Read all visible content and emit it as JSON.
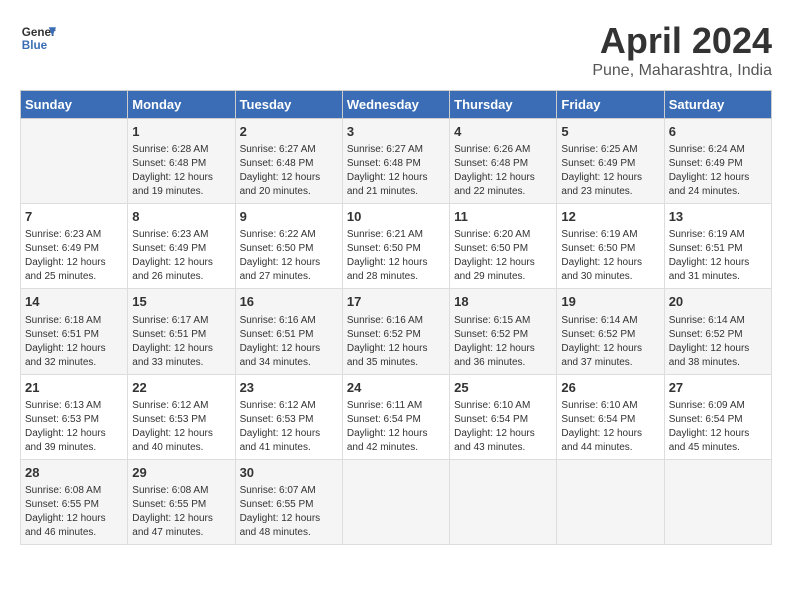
{
  "header": {
    "logo_line1": "General",
    "logo_line2": "Blue",
    "title": "April 2024",
    "subtitle": "Pune, Maharashtra, India"
  },
  "calendar": {
    "columns": [
      "Sunday",
      "Monday",
      "Tuesday",
      "Wednesday",
      "Thursday",
      "Friday",
      "Saturday"
    ],
    "rows": [
      [
        {
          "day": "",
          "sunrise": "",
          "sunset": "",
          "daylight": ""
        },
        {
          "day": "1",
          "sunrise": "Sunrise: 6:28 AM",
          "sunset": "Sunset: 6:48 PM",
          "daylight": "Daylight: 12 hours and 19 minutes."
        },
        {
          "day": "2",
          "sunrise": "Sunrise: 6:27 AM",
          "sunset": "Sunset: 6:48 PM",
          "daylight": "Daylight: 12 hours and 20 minutes."
        },
        {
          "day": "3",
          "sunrise": "Sunrise: 6:27 AM",
          "sunset": "Sunset: 6:48 PM",
          "daylight": "Daylight: 12 hours and 21 minutes."
        },
        {
          "day": "4",
          "sunrise": "Sunrise: 6:26 AM",
          "sunset": "Sunset: 6:48 PM",
          "daylight": "Daylight: 12 hours and 22 minutes."
        },
        {
          "day": "5",
          "sunrise": "Sunrise: 6:25 AM",
          "sunset": "Sunset: 6:49 PM",
          "daylight": "Daylight: 12 hours and 23 minutes."
        },
        {
          "day": "6",
          "sunrise": "Sunrise: 6:24 AM",
          "sunset": "Sunset: 6:49 PM",
          "daylight": "Daylight: 12 hours and 24 minutes."
        }
      ],
      [
        {
          "day": "7",
          "sunrise": "Sunrise: 6:23 AM",
          "sunset": "Sunset: 6:49 PM",
          "daylight": "Daylight: 12 hours and 25 minutes."
        },
        {
          "day": "8",
          "sunrise": "Sunrise: 6:23 AM",
          "sunset": "Sunset: 6:49 PM",
          "daylight": "Daylight: 12 hours and 26 minutes."
        },
        {
          "day": "9",
          "sunrise": "Sunrise: 6:22 AM",
          "sunset": "Sunset: 6:50 PM",
          "daylight": "Daylight: 12 hours and 27 minutes."
        },
        {
          "day": "10",
          "sunrise": "Sunrise: 6:21 AM",
          "sunset": "Sunset: 6:50 PM",
          "daylight": "Daylight: 12 hours and 28 minutes."
        },
        {
          "day": "11",
          "sunrise": "Sunrise: 6:20 AM",
          "sunset": "Sunset: 6:50 PM",
          "daylight": "Daylight: 12 hours and 29 minutes."
        },
        {
          "day": "12",
          "sunrise": "Sunrise: 6:19 AM",
          "sunset": "Sunset: 6:50 PM",
          "daylight": "Daylight: 12 hours and 30 minutes."
        },
        {
          "day": "13",
          "sunrise": "Sunrise: 6:19 AM",
          "sunset": "Sunset: 6:51 PM",
          "daylight": "Daylight: 12 hours and 31 minutes."
        }
      ],
      [
        {
          "day": "14",
          "sunrise": "Sunrise: 6:18 AM",
          "sunset": "Sunset: 6:51 PM",
          "daylight": "Daylight: 12 hours and 32 minutes."
        },
        {
          "day": "15",
          "sunrise": "Sunrise: 6:17 AM",
          "sunset": "Sunset: 6:51 PM",
          "daylight": "Daylight: 12 hours and 33 minutes."
        },
        {
          "day": "16",
          "sunrise": "Sunrise: 6:16 AM",
          "sunset": "Sunset: 6:51 PM",
          "daylight": "Daylight: 12 hours and 34 minutes."
        },
        {
          "day": "17",
          "sunrise": "Sunrise: 6:16 AM",
          "sunset": "Sunset: 6:52 PM",
          "daylight": "Daylight: 12 hours and 35 minutes."
        },
        {
          "day": "18",
          "sunrise": "Sunrise: 6:15 AM",
          "sunset": "Sunset: 6:52 PM",
          "daylight": "Daylight: 12 hours and 36 minutes."
        },
        {
          "day": "19",
          "sunrise": "Sunrise: 6:14 AM",
          "sunset": "Sunset: 6:52 PM",
          "daylight": "Daylight: 12 hours and 37 minutes."
        },
        {
          "day": "20",
          "sunrise": "Sunrise: 6:14 AM",
          "sunset": "Sunset: 6:52 PM",
          "daylight": "Daylight: 12 hours and 38 minutes."
        }
      ],
      [
        {
          "day": "21",
          "sunrise": "Sunrise: 6:13 AM",
          "sunset": "Sunset: 6:53 PM",
          "daylight": "Daylight: 12 hours and 39 minutes."
        },
        {
          "day": "22",
          "sunrise": "Sunrise: 6:12 AM",
          "sunset": "Sunset: 6:53 PM",
          "daylight": "Daylight: 12 hours and 40 minutes."
        },
        {
          "day": "23",
          "sunrise": "Sunrise: 6:12 AM",
          "sunset": "Sunset: 6:53 PM",
          "daylight": "Daylight: 12 hours and 41 minutes."
        },
        {
          "day": "24",
          "sunrise": "Sunrise: 6:11 AM",
          "sunset": "Sunset: 6:54 PM",
          "daylight": "Daylight: 12 hours and 42 minutes."
        },
        {
          "day": "25",
          "sunrise": "Sunrise: 6:10 AM",
          "sunset": "Sunset: 6:54 PM",
          "daylight": "Daylight: 12 hours and 43 minutes."
        },
        {
          "day": "26",
          "sunrise": "Sunrise: 6:10 AM",
          "sunset": "Sunset: 6:54 PM",
          "daylight": "Daylight: 12 hours and 44 minutes."
        },
        {
          "day": "27",
          "sunrise": "Sunrise: 6:09 AM",
          "sunset": "Sunset: 6:54 PM",
          "daylight": "Daylight: 12 hours and 45 minutes."
        }
      ],
      [
        {
          "day": "28",
          "sunrise": "Sunrise: 6:08 AM",
          "sunset": "Sunset: 6:55 PM",
          "daylight": "Daylight: 12 hours and 46 minutes."
        },
        {
          "day": "29",
          "sunrise": "Sunrise: 6:08 AM",
          "sunset": "Sunset: 6:55 PM",
          "daylight": "Daylight: 12 hours and 47 minutes."
        },
        {
          "day": "30",
          "sunrise": "Sunrise: 6:07 AM",
          "sunset": "Sunset: 6:55 PM",
          "daylight": "Daylight: 12 hours and 48 minutes."
        },
        {
          "day": "",
          "sunrise": "",
          "sunset": "",
          "daylight": ""
        },
        {
          "day": "",
          "sunrise": "",
          "sunset": "",
          "daylight": ""
        },
        {
          "day": "",
          "sunrise": "",
          "sunset": "",
          "daylight": ""
        },
        {
          "day": "",
          "sunrise": "",
          "sunset": "",
          "daylight": ""
        }
      ]
    ]
  }
}
